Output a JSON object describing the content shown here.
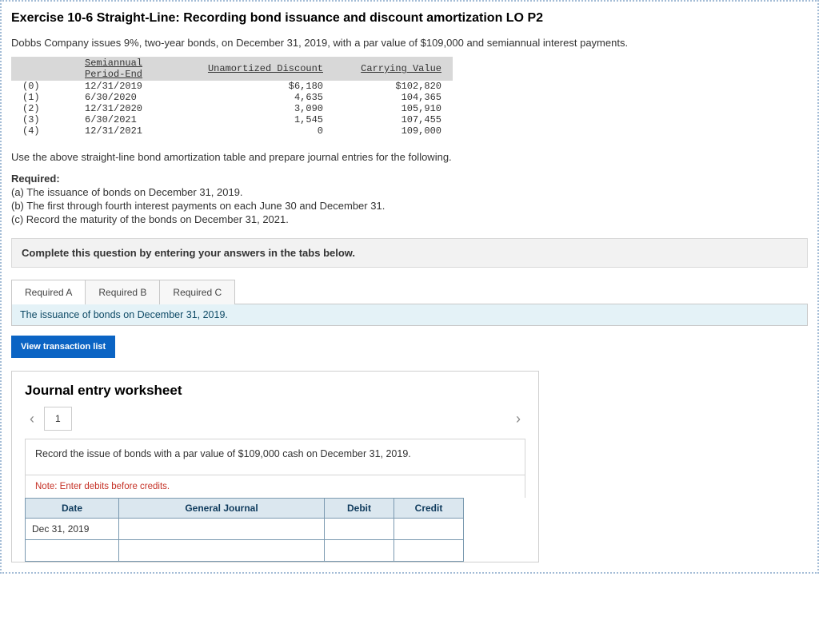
{
  "title": "Exercise 10-6 Straight-Line: Recording bond issuance and discount amortization LO P2",
  "intro": "Dobbs Company issues 9%, two-year bonds, on December 31, 2019, with a par value of $109,000 and semiannual interest payments.",
  "amort_table": {
    "headers": {
      "period": "Semiannual Period-End",
      "discount": "Unamortized Discount",
      "carrying": "Carrying Value"
    },
    "rows": [
      {
        "idx": "(0)",
        "period": "12/31/2019",
        "discount": "$6,180",
        "carrying": "$102,820"
      },
      {
        "idx": "(1)",
        "period": "6/30/2020",
        "discount": "4,635",
        "carrying": "104,365"
      },
      {
        "idx": "(2)",
        "period": "12/31/2020",
        "discount": "3,090",
        "carrying": "105,910"
      },
      {
        "idx": "(3)",
        "period": "6/30/2021",
        "discount": "1,545",
        "carrying": "107,455"
      },
      {
        "idx": "(4)",
        "period": "12/31/2021",
        "discount": "0",
        "carrying": "109,000"
      }
    ]
  },
  "use_line": "Use the above straight-line bond amortization table and prepare journal entries for the following.",
  "required": {
    "heading": "Required:",
    "a": "(a) The issuance of bonds on December 31, 2019.",
    "b": "(b) The first through fourth interest payments on each June 30 and December 31.",
    "c": "(c) Record the maturity of the bonds on December 31, 2021."
  },
  "instruction_bar": "Complete this question by entering your answers in the tabs below.",
  "tabs": {
    "a": "Required A",
    "b": "Required B",
    "c": "Required C"
  },
  "context_strip": "The issuance of bonds on December 31, 2019.",
  "view_btn": "View transaction list",
  "worksheet": {
    "title": "Journal entry worksheet",
    "step": "1",
    "instruction": "Record the issue of bonds with a par value of $109,000 cash on December 31, 2019.",
    "note": "Note: Enter debits before credits.",
    "columns": {
      "date": "Date",
      "gj": "General Journal",
      "debit": "Debit",
      "credit": "Credit"
    },
    "rows": [
      {
        "date": "Dec 31, 2019",
        "gj": "",
        "debit": "",
        "credit": ""
      },
      {
        "date": "",
        "gj": "",
        "debit": "",
        "credit": ""
      }
    ]
  }
}
